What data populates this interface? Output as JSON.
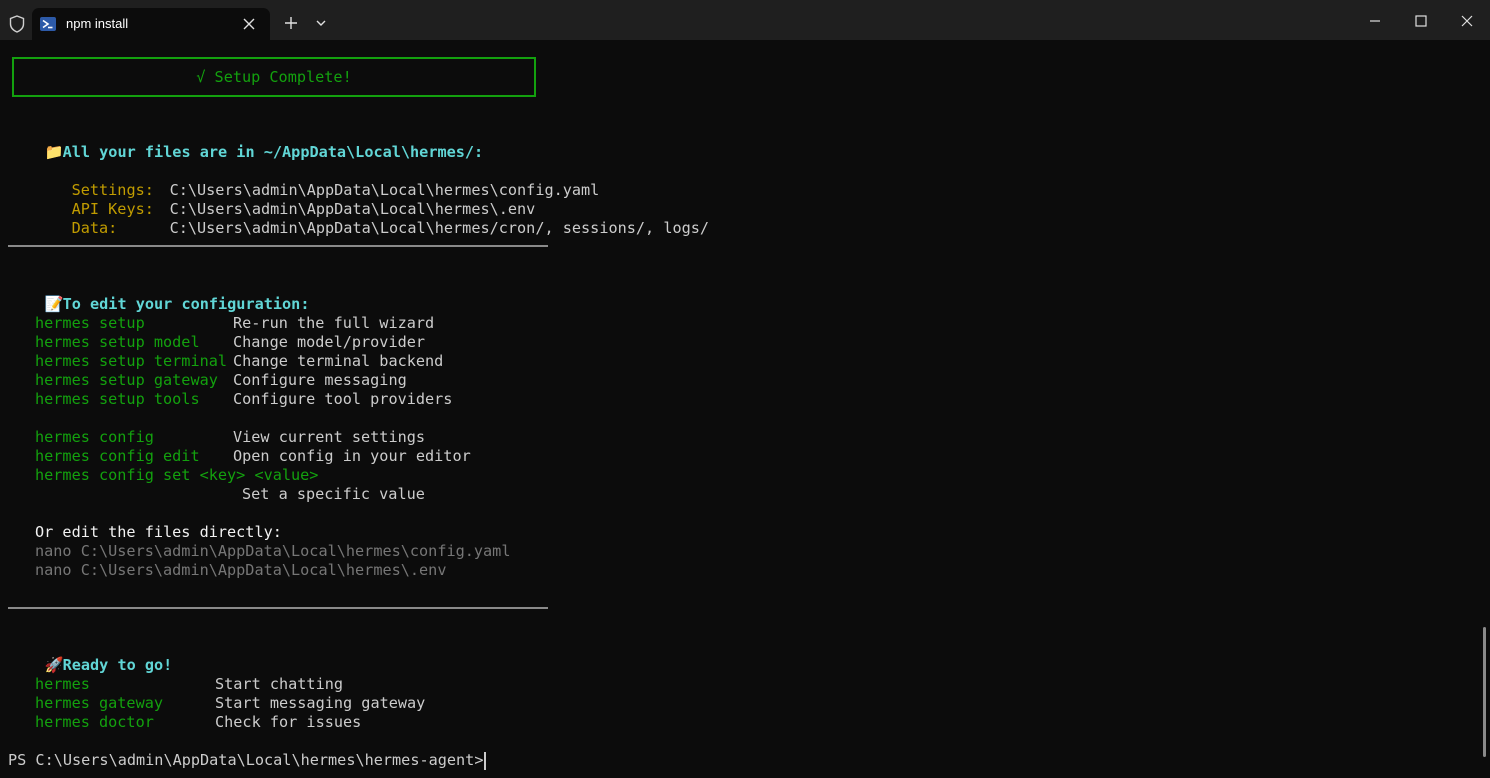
{
  "window": {
    "tab_title": "npm install",
    "icons": [
      "shield-icon",
      "powershell-icon",
      "close-icon",
      "plus-icon",
      "chevron-down-icon",
      "minimize-icon",
      "maximize-icon",
      "close-window-icon"
    ]
  },
  "terminal": {
    "banner": "√ Setup Complete!",
    "files_heading": "All your files are in ~/AppData\\Local\\hermes/:",
    "files": [
      {
        "label": "Settings:",
        "path": "C:\\Users\\admin\\AppData\\Local\\hermes\\config.yaml"
      },
      {
        "label": "API Keys:",
        "path": "C:\\Users\\admin\\AppData\\Local\\hermes\\.env"
      },
      {
        "label": "Data:",
        "path": "C:\\Users\\admin\\AppData\\Local\\hermes/cron/, sessions/, logs/"
      }
    ],
    "edit_heading": "To edit your configuration:",
    "setup_commands": [
      {
        "cmd": "hermes setup",
        "desc": "Re-run the full wizard"
      },
      {
        "cmd": "hermes setup model",
        "desc": "Change model/provider"
      },
      {
        "cmd": "hermes setup terminal",
        "desc": "Change terminal backend"
      },
      {
        "cmd": "hermes setup gateway",
        "desc": "Configure messaging"
      },
      {
        "cmd": "hermes setup tools",
        "desc": "Configure tool providers"
      }
    ],
    "config_commands": [
      {
        "cmd": "hermes config",
        "desc": "View current settings"
      },
      {
        "cmd": "hermes config edit",
        "desc": "Open config in your editor"
      },
      {
        "cmd": "hermes config set <key> <value>",
        "desc": "Set a specific value"
      }
    ],
    "direct_edit_heading": "Or edit the files directly:",
    "direct_edit_lines": [
      "nano C:\\Users\\admin\\AppData\\Local\\hermes\\config.yaml",
      "nano C:\\Users\\admin\\AppData\\Local\\hermes\\.env"
    ],
    "ready_heading": "Ready to go!",
    "ready_commands": [
      {
        "cmd": "hermes",
        "desc": "Start chatting"
      },
      {
        "cmd": "hermes gateway",
        "desc": "Start messaging gateway"
      },
      {
        "cmd": "hermes doctor",
        "desc": "Check for issues"
      }
    ],
    "prompt": "PS C:\\Users\\admin\\AppData\\Local\\hermes\\hermes-agent> "
  }
}
